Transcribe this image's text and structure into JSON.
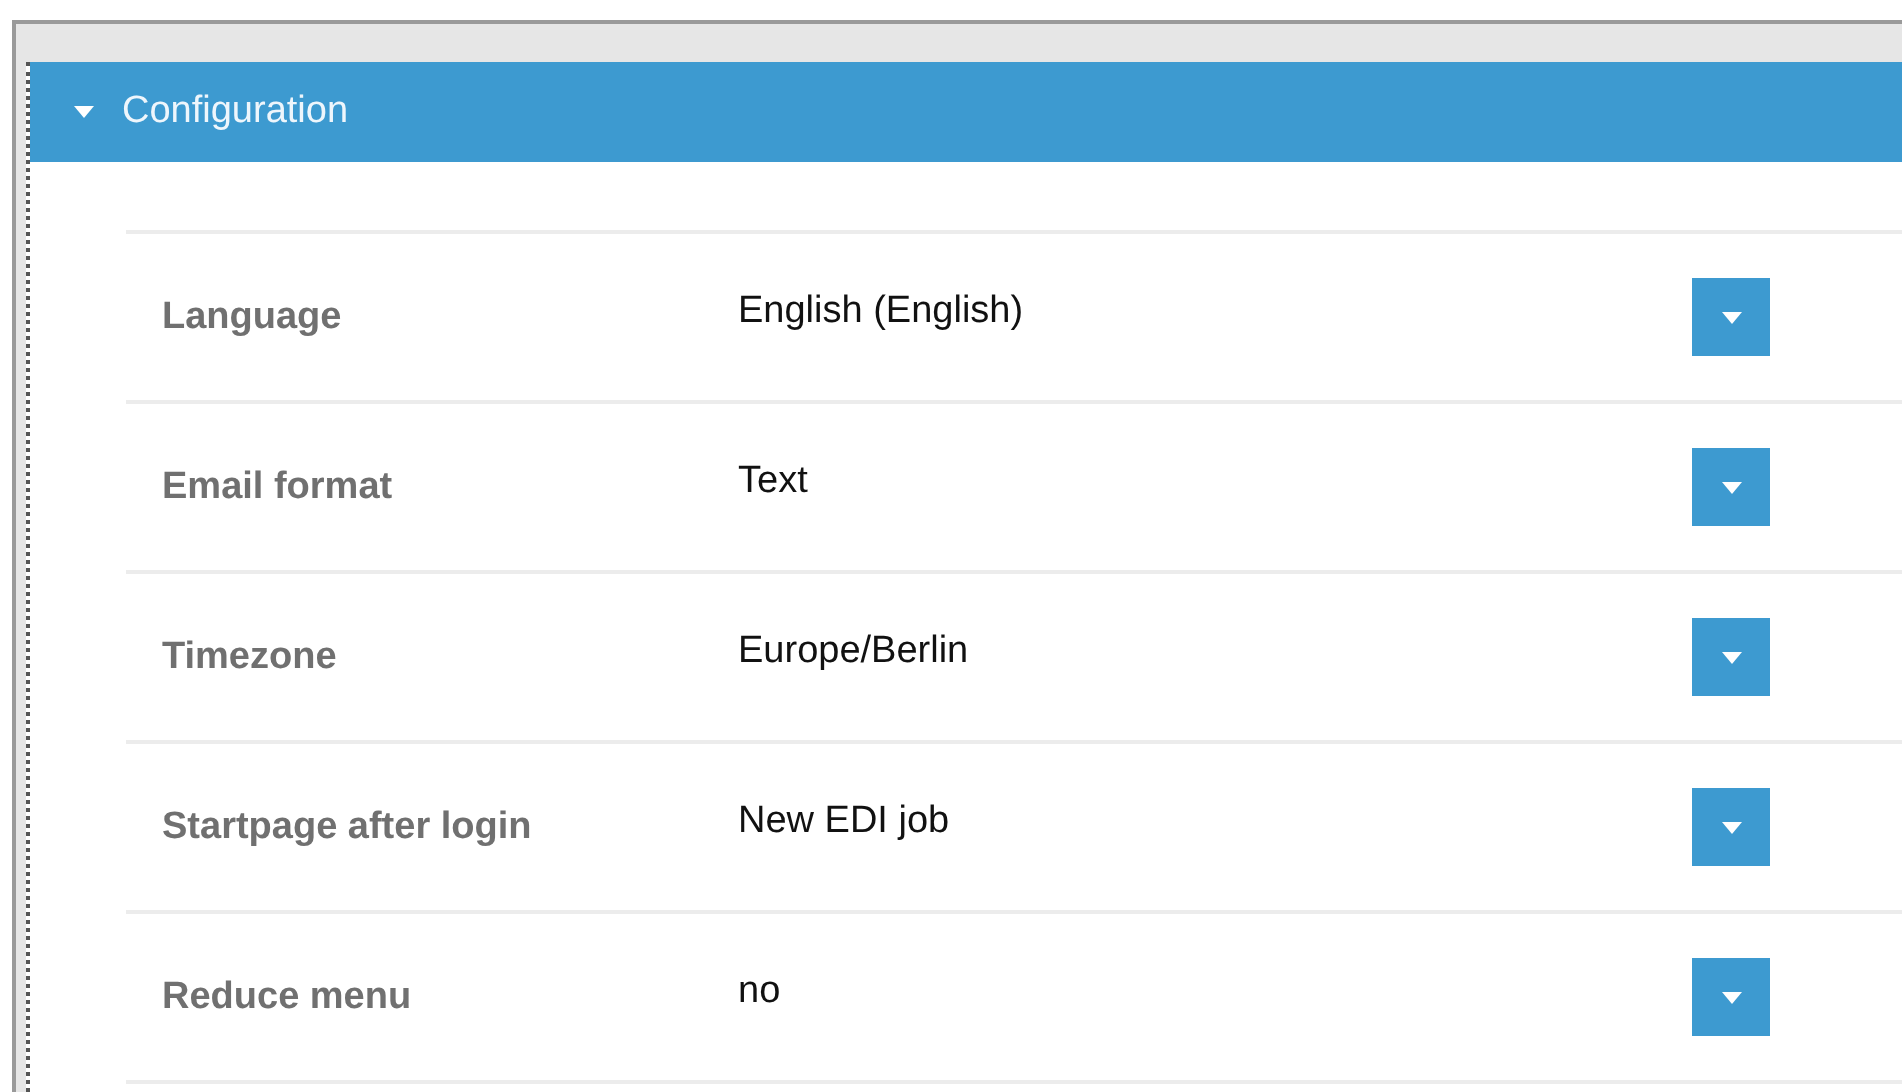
{
  "panel": {
    "title": "Configuration",
    "expanded": true
  },
  "settings": [
    {
      "label": "Language",
      "value": "English (English)"
    },
    {
      "label": "Email format",
      "value": "Text"
    },
    {
      "label": "Timezone",
      "value": "Europe/Berlin"
    },
    {
      "label": "Startpage after login",
      "value": "New EDI job"
    },
    {
      "label": "Reduce menu",
      "value": "no"
    }
  ]
}
